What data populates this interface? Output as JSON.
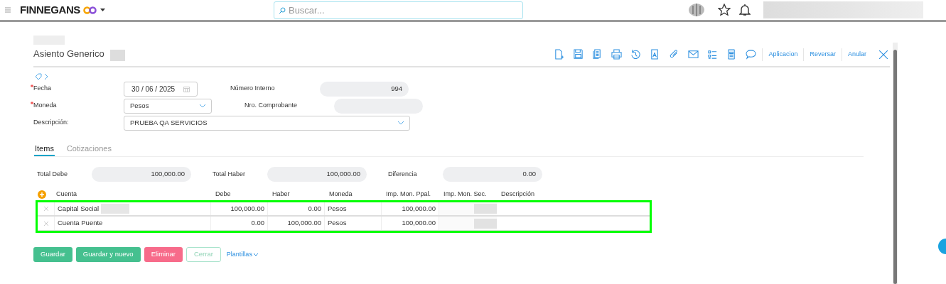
{
  "header": {
    "brand": "FINNEGANS",
    "search_placeholder": "Buscar..."
  },
  "form": {
    "title": "Asiento Generico",
    "actions": [
      "Aplicacion",
      "Reversar",
      "Anular"
    ],
    "rows": [
      [
        {
          "label": "Fecha",
          "required": true,
          "kind": "date",
          "value": "30 / 06 / 2025"
        },
        {
          "label": "Número Interno",
          "required": false,
          "kind": "readonly",
          "value": "994"
        }
      ],
      [
        {
          "label": "Moneda",
          "required": true,
          "kind": "select",
          "value": "Pesos"
        },
        {
          "label": "Nro. Comprobante",
          "required": false,
          "kind": "readonly"
        }
      ],
      [
        {
          "label": "Descripción:",
          "required": false,
          "kind": "wide-select",
          "value": "PRUEBA QA SERVICIOS"
        }
      ]
    ]
  },
  "tabs": [
    {
      "label": "Items",
      "selected": true
    },
    {
      "label": "Cotizaciones",
      "selected": false
    }
  ],
  "totals": [
    {
      "label": "Total Debe",
      "value": "100,000.00"
    },
    {
      "label": "Total Haber",
      "value": "100,000.00"
    },
    {
      "label": "Diferencia",
      "value": "0.00"
    }
  ],
  "table": {
    "columns": [
      "Cuenta",
      "Debe",
      "Haber",
      "Moneda",
      "Imp. Mon. Ppal.",
      "Imp. Mon. Sec.",
      "Descripción"
    ],
    "rows": [
      {
        "cuenta": "Capital Social",
        "debe": "100,000.00",
        "haber": "0.00",
        "moneda": "Pesos",
        "imp_ppal": "100,000.00"
      },
      {
        "cuenta": "Cuenta Puente",
        "debe": "0.00",
        "haber": "100,000.00",
        "moneda": "Pesos",
        "imp_ppal": "100,000.00"
      }
    ]
  },
  "buttons": [
    {
      "label": "Guardar",
      "kind": "primary"
    },
    {
      "label": "Guardar y nuevo",
      "kind": "primary"
    },
    {
      "label": "Eliminar",
      "kind": "danger"
    },
    {
      "label": "Cerrar",
      "kind": "outline"
    },
    {
      "label": "Plantillas",
      "kind": "link"
    }
  ]
}
